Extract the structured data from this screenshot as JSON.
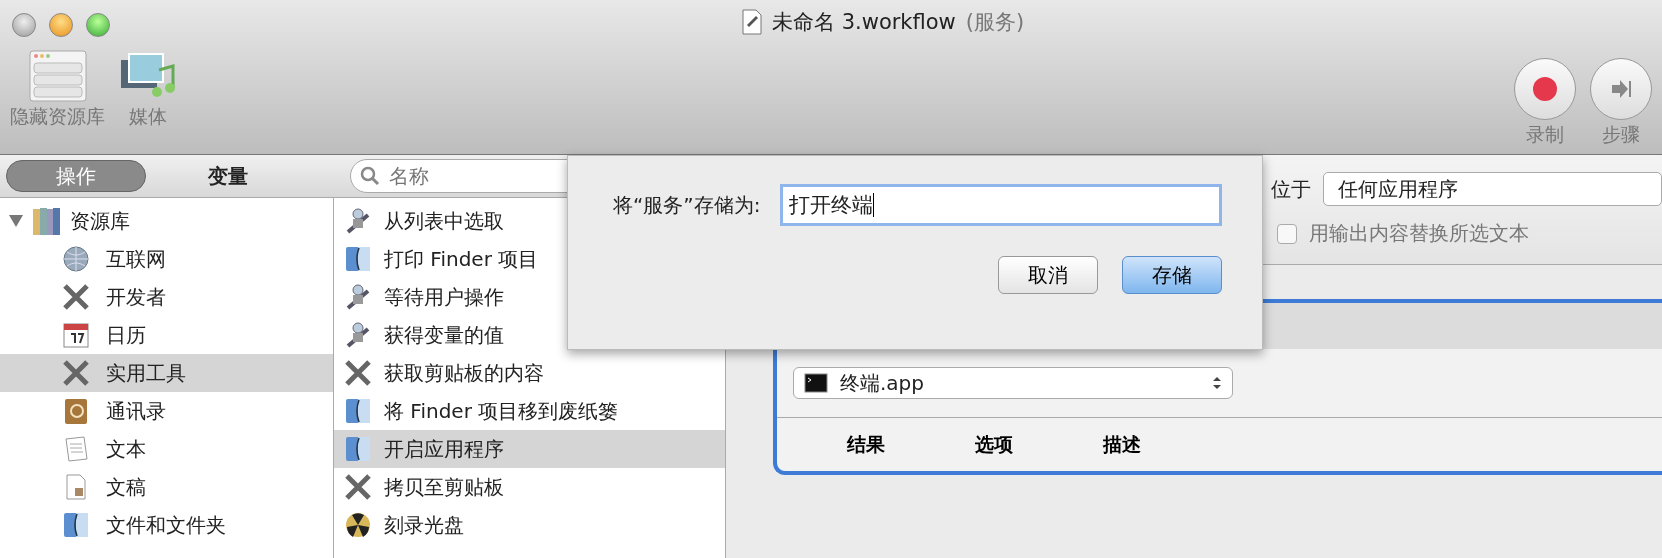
{
  "window": {
    "title": "未命名 3.workflow",
    "title_suffix": "(服务)"
  },
  "toolbar": {
    "left": [
      {
        "kind": "library",
        "label": "隐藏资源库"
      },
      {
        "kind": "media",
        "label": "媒体"
      }
    ],
    "right": [
      {
        "kind": "record",
        "label": "录制"
      },
      {
        "kind": "step",
        "label": "步骤"
      }
    ]
  },
  "tabs": [
    {
      "label": "操作",
      "selected": true
    },
    {
      "label": "变量",
      "selected": false
    }
  ],
  "search": {
    "placeholder": "名称"
  },
  "library": {
    "label": "资源库",
    "expanded": true,
    "children": [
      {
        "kind": "globe",
        "label": "互联网",
        "selected": false
      },
      {
        "kind": "tools",
        "label": "开发者",
        "selected": false
      },
      {
        "kind": "calendar",
        "label": "日历",
        "selected": false
      },
      {
        "kind": "tools",
        "label": "实用工具",
        "selected": true
      },
      {
        "kind": "contacts",
        "label": "通讯录",
        "selected": false
      },
      {
        "kind": "text",
        "label": "文本",
        "selected": false
      },
      {
        "kind": "document",
        "label": "文稿",
        "selected": false
      },
      {
        "kind": "finder",
        "label": "文件和文件夹",
        "selected": false
      }
    ]
  },
  "actions": [
    {
      "kind": "robot",
      "label": "从列表中选取",
      "selected": false
    },
    {
      "kind": "finder",
      "label": "打印 Finder 项目",
      "selected": false
    },
    {
      "kind": "robot",
      "label": "等待用户操作",
      "selected": false
    },
    {
      "kind": "robot",
      "label": "获得变量的值",
      "selected": false
    },
    {
      "kind": "tools",
      "label": "获取剪贴板的内容",
      "selected": false
    },
    {
      "kind": "finder",
      "label": "将 Finder 项目移到废纸篓",
      "selected": false
    },
    {
      "kind": "finder",
      "label": "开启应用程序",
      "selected": true
    },
    {
      "kind": "tools",
      "label": "拷贝至剪贴板",
      "selected": false
    },
    {
      "kind": "disc",
      "label": "刻录光盘",
      "selected": false
    }
  ],
  "service": {
    "location_label": "位于",
    "location_value": "任何应用程序",
    "replace_label": "用输出内容替换所选文本",
    "replace_checked": false
  },
  "workflow_action": {
    "app": "终端.app",
    "footer_tabs": [
      "结果",
      "选项",
      "描述"
    ]
  },
  "dialog": {
    "label": "将“服务”存储为:",
    "value": "打开终端",
    "buttons": [
      {
        "label": "取消",
        "default": false
      },
      {
        "label": "存储",
        "default": true
      }
    ]
  }
}
